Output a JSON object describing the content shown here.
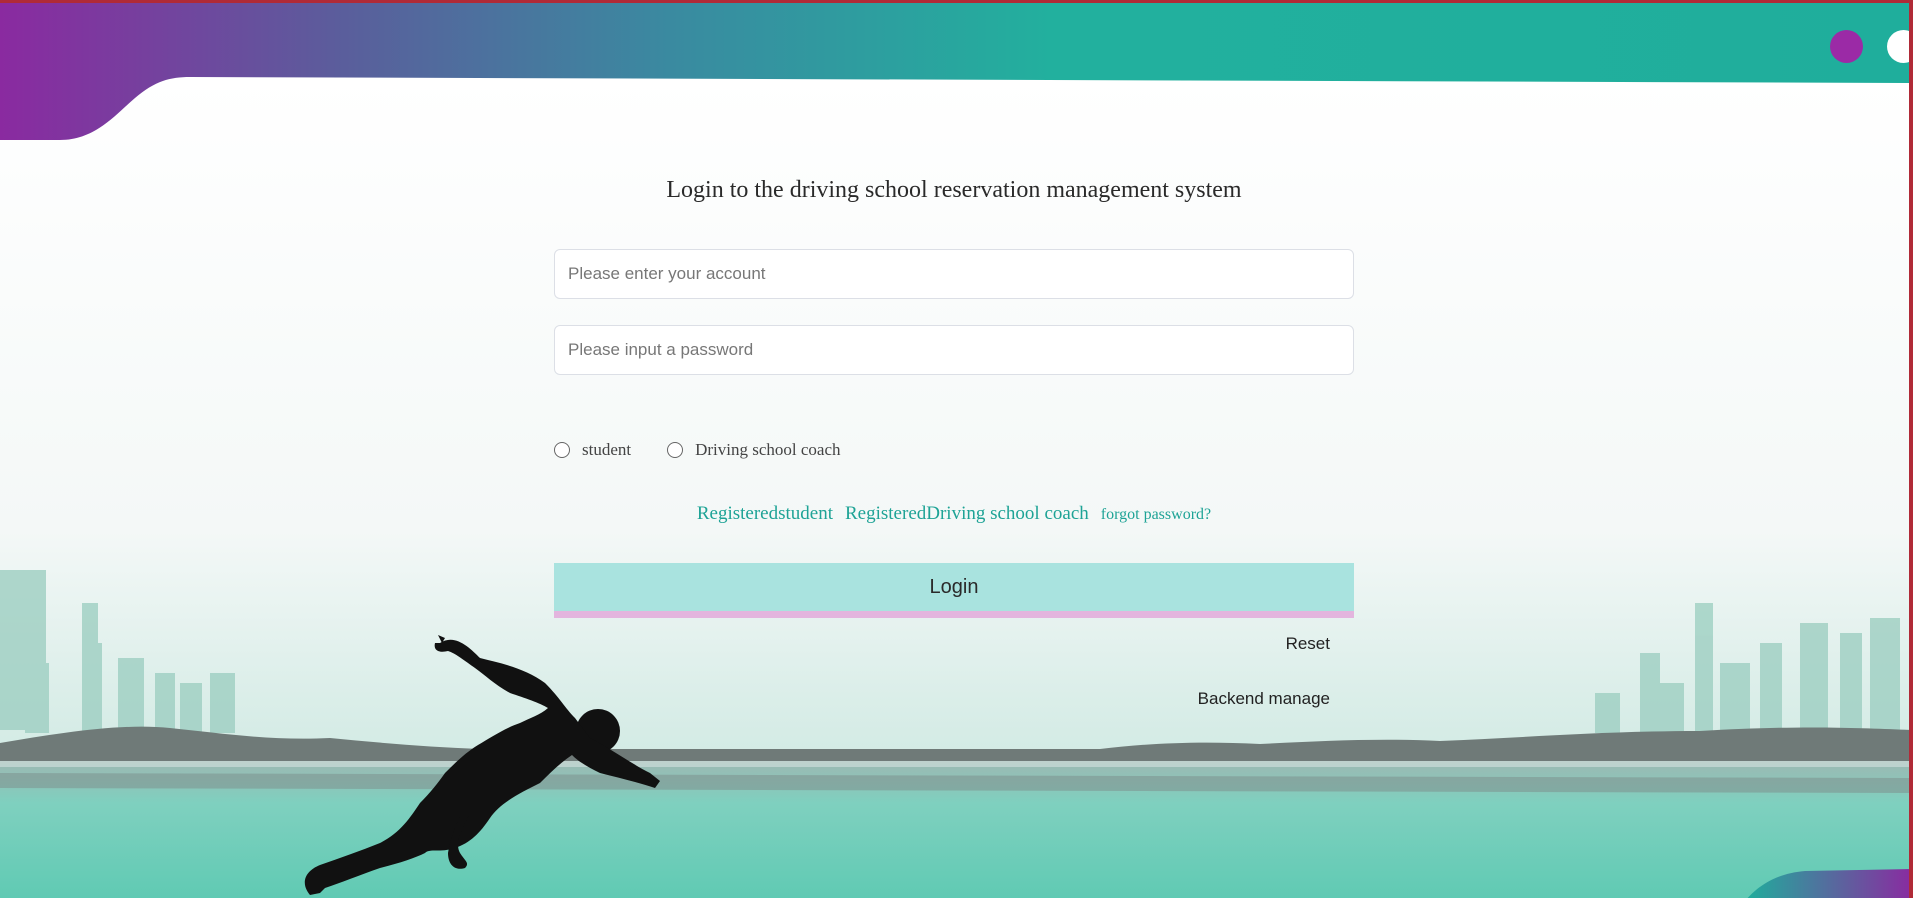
{
  "page": {
    "title": "Login to the driving school reservation management system"
  },
  "form": {
    "account_placeholder": "Please enter your account",
    "password_placeholder": "Please input a password",
    "roles": [
      {
        "label": "student",
        "selected": false
      },
      {
        "label": "Driving school coach",
        "selected": false
      }
    ]
  },
  "links": {
    "register_student": "Registeredstudent",
    "register_coach": "RegisteredDriving school coach",
    "forgot_password": "forgot password?"
  },
  "buttons": {
    "login": "Login",
    "reset": "Reset",
    "backend": "Backend manage"
  },
  "colors": {
    "accent": "#1ea396",
    "login_button": "#a9e3df",
    "header_start": "#8a2aa0",
    "header_end": "#1fae9c"
  }
}
